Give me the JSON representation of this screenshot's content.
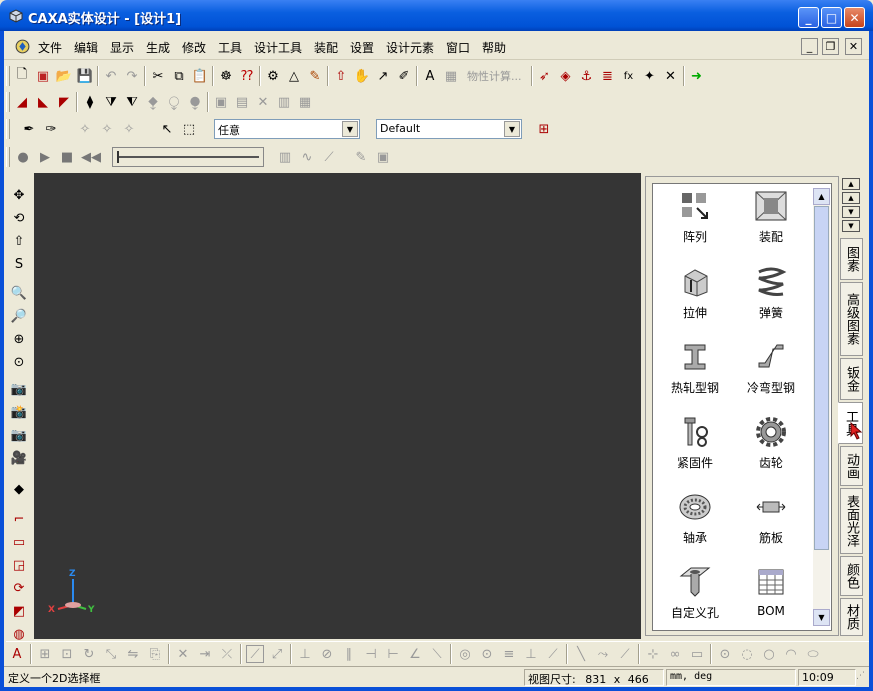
{
  "window": {
    "title": "CAXA实体设计 - [设计1]"
  },
  "menu": [
    "文件",
    "编辑",
    "显示",
    "生成",
    "修改",
    "工具",
    "设计工具",
    "装配",
    "设置",
    "设计元素",
    "窗口",
    "帮助"
  ],
  "toolbar": {
    "mass_props_label": "物性计算...",
    "select_filter_value": "任意",
    "style_value": "Default"
  },
  "library": {
    "items": [
      {
        "label": "阵列",
        "icon": "array-icon"
      },
      {
        "label": "装配",
        "icon": "assembly-icon"
      },
      {
        "label": "拉伸",
        "icon": "extrude-icon"
      },
      {
        "label": "弹簧",
        "icon": "spring-icon"
      },
      {
        "label": "热轧型钢",
        "icon": "hot-rolled-steel-icon"
      },
      {
        "label": "冷弯型钢",
        "icon": "cold-formed-steel-icon"
      },
      {
        "label": "紧固件",
        "icon": "fastener-icon"
      },
      {
        "label": "齿轮",
        "icon": "gear-icon"
      },
      {
        "label": "轴承",
        "icon": "bearing-icon"
      },
      {
        "label": "筋板",
        "icon": "rib-icon"
      },
      {
        "label": "自定义孔",
        "icon": "custom-hole-icon"
      },
      {
        "label": "BOM",
        "icon": "bom-icon"
      }
    ]
  },
  "tabs": [
    "图素",
    "高级图素",
    "钣金",
    "工具",
    "动画",
    "表面光泽",
    "颜色",
    "材质"
  ],
  "active_tab": "工具",
  "axes": {
    "x": "X",
    "y": "Y",
    "z": "Z"
  },
  "status": {
    "message": "定义一个2D选择框",
    "view_size_label": "视图尺寸:",
    "view_width": "831",
    "times": "x",
    "view_height": "466",
    "units": "mm, deg",
    "time": "10:09"
  },
  "colors": {
    "titlebar": "#0a5fe0",
    "viewport": "#353535",
    "panel": "#ece9d8"
  }
}
